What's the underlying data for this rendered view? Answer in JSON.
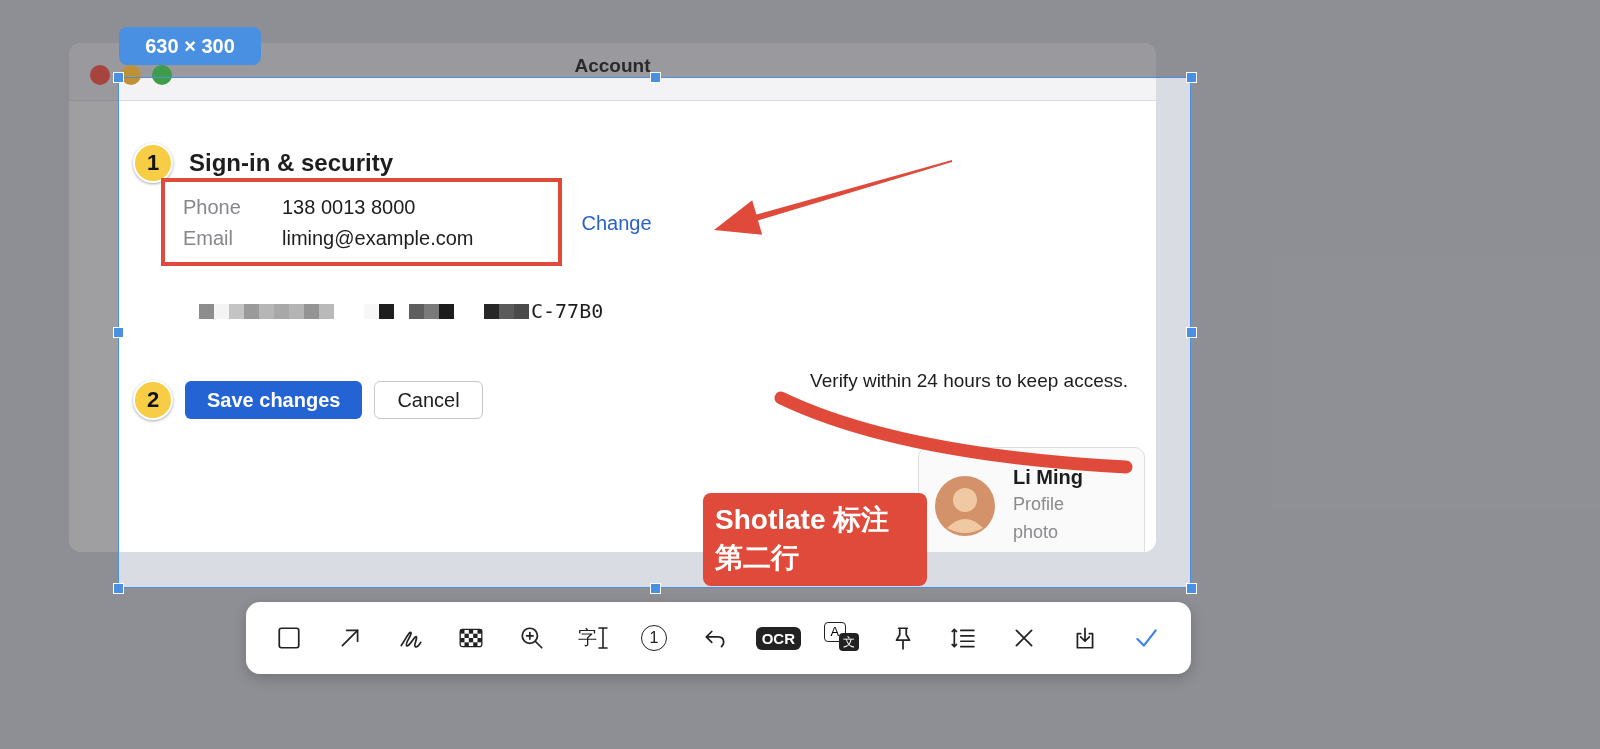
{
  "selection": {
    "size_label": "630 × 300"
  },
  "window": {
    "title": "Account"
  },
  "section": {
    "step": "1",
    "title": "Sign-in & security",
    "fields": [
      {
        "label": "Phone",
        "value": "138 0013 8000"
      },
      {
        "label": "Email",
        "value": "liming@example.com"
      }
    ],
    "link": "Change",
    "redacted_text": "C-77B0"
  },
  "actions": {
    "step": "2",
    "buttons": [
      {
        "label": "Save changes",
        "kind": "primary"
      },
      {
        "label": "Cancel",
        "kind": "secondary"
      }
    ]
  },
  "notice": "Verify within 24 hours to keep access.",
  "profile_card": {
    "name": "Li Ming",
    "caption_lines": [
      "Profile",
      "photo"
    ]
  },
  "text_note": {
    "lines": [
      "Shotlate 标注",
      "第二行"
    ]
  },
  "toolbar": [
    {
      "kind": "rectangle"
    },
    {
      "kind": "arrow"
    },
    {
      "kind": "pen"
    },
    {
      "kind": "mosaic"
    },
    {
      "kind": "magnifier"
    },
    {
      "kind": "text",
      "glyph": "字"
    },
    {
      "kind": "number",
      "glyph": "1"
    },
    {
      "kind": "undo"
    },
    {
      "kind": "ocr",
      "glyph": "OCR"
    },
    {
      "kind": "translate",
      "glyphs": [
        "A",
        "文"
      ]
    },
    {
      "kind": "pin"
    },
    {
      "kind": "spacing"
    },
    {
      "kind": "close"
    },
    {
      "kind": "save"
    },
    {
      "kind": "confirm"
    }
  ]
}
